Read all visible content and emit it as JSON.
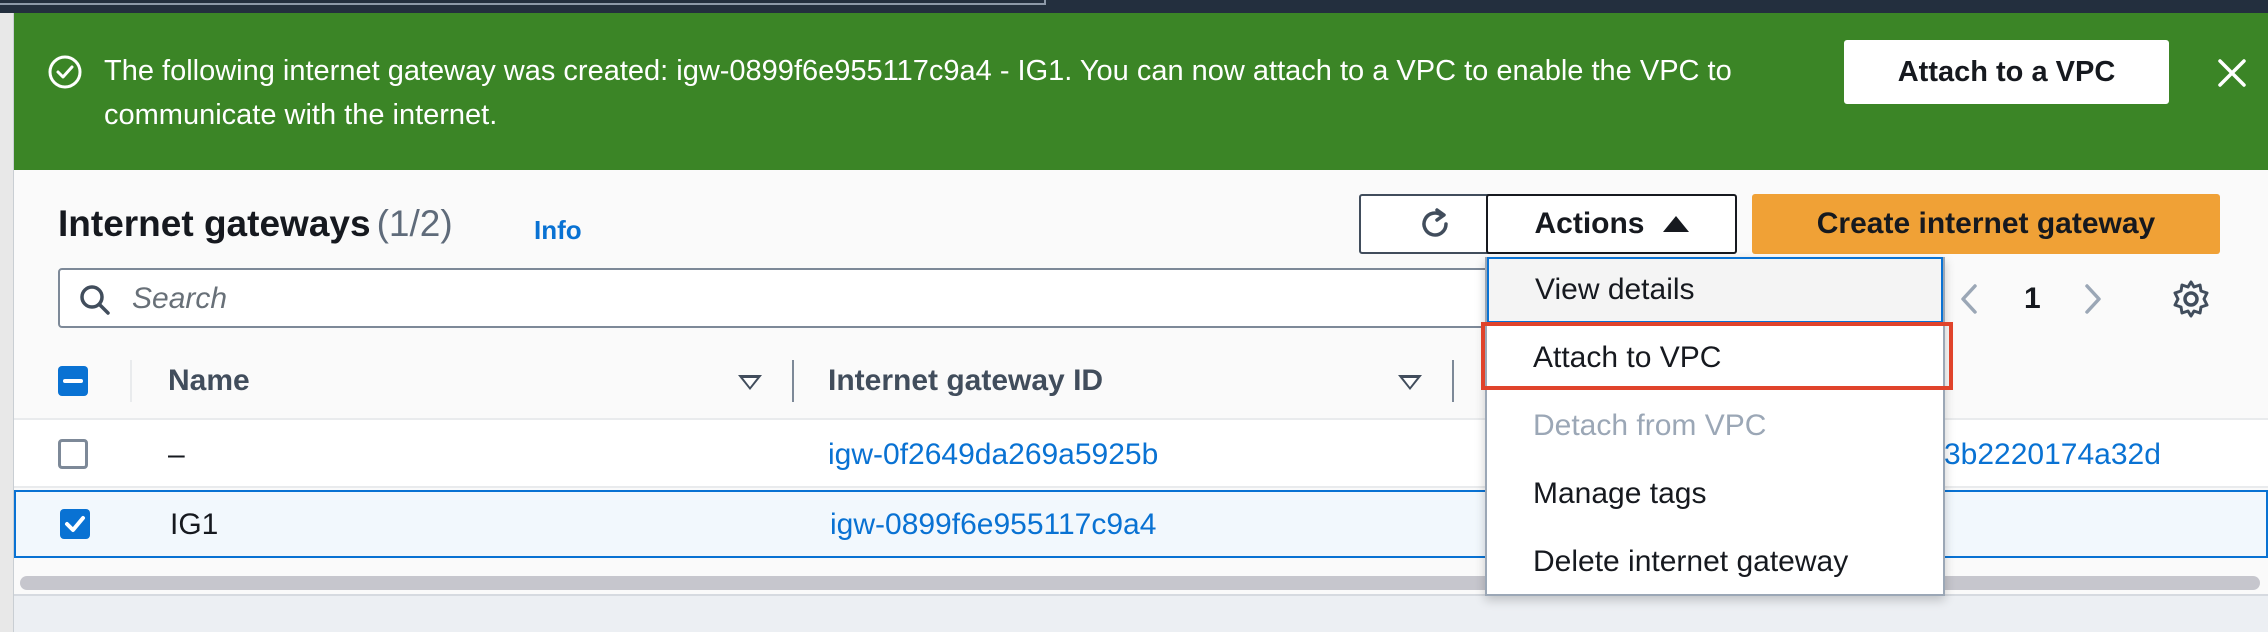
{
  "flash": {
    "message": "The following internet gateway was created: igw-0899f6e955117c9a4 - IG1. You can now attach to a VPC to enable the VPC to communicate with the internet.",
    "attach_button": "Attach to a VPC",
    "icons": {
      "status": "check-circle-icon",
      "dismiss": "close-icon"
    },
    "color": "#3b8526"
  },
  "header": {
    "title": "Internet gateways",
    "count": "(1/2)",
    "info": "Info"
  },
  "toolbar": {
    "actions_label": "Actions",
    "create_label": "Create internet gateway",
    "create_color": "#f0a136"
  },
  "search": {
    "placeholder": "Search"
  },
  "pagination": {
    "current_page": "1"
  },
  "table": {
    "columns": [
      "Name",
      "Internet gateway ID"
    ],
    "rows": [
      {
        "name": "–",
        "igw_id": "igw-0f2649da269a5925b",
        "extra": "3b2220174a32d",
        "selected": false
      },
      {
        "name": "IG1",
        "igw_id": "igw-0899f6e955117c9a4",
        "extra": "",
        "selected": true
      }
    ]
  },
  "actions_menu": {
    "items": [
      {
        "label": "View details",
        "enabled": true
      },
      {
        "label": "Attach to VPC",
        "enabled": true
      },
      {
        "label": "Detach from VPC",
        "enabled": false
      },
      {
        "label": "Manage tags",
        "enabled": true
      },
      {
        "label": "Delete internet gateway",
        "enabled": true
      }
    ],
    "highlight_color": "#e0432b"
  },
  "link_color": "#0972d3"
}
